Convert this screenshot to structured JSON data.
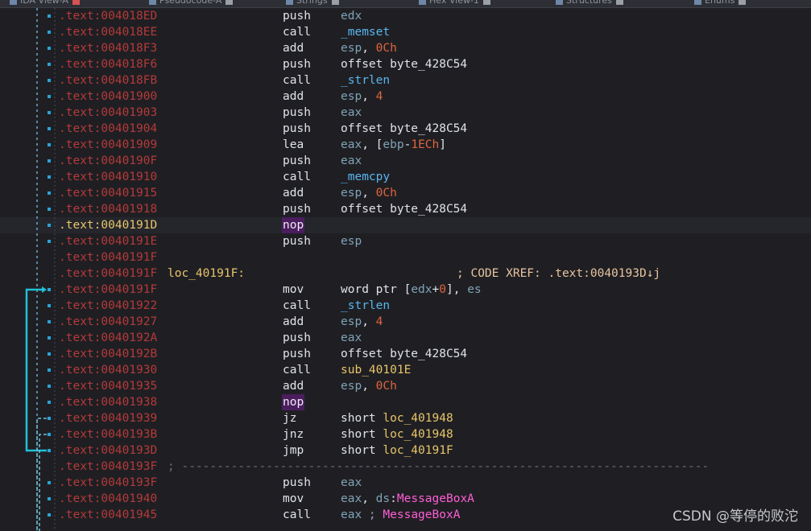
{
  "tabs": [
    {
      "label": "IDA View-A",
      "active": true
    },
    {
      "label": "Pseudocode-A",
      "active": false
    },
    {
      "label": "Strings",
      "active": false
    },
    {
      "label": "Hex View-1",
      "active": false
    },
    {
      "label": "Structures",
      "active": false
    },
    {
      "label": "Enums",
      "active": false
    }
  ],
  "watermark": "CSDN @等停的败沱",
  "colors": {
    "address": "#b33a3a",
    "address_current": "#e8c56a",
    "label": "#e8c56a",
    "register": "#7fa2b6",
    "number": "#e0653e",
    "function": "#59b6ef",
    "import": "#ff5dd6",
    "nop_bg": "#4a1d5d",
    "arrow": "#20c0d8"
  },
  "rows": [
    {
      "addr": ".text:004018ED",
      "mn": "push",
      "ops": [
        {
          "t": "edx",
          "c": "reg"
        }
      ]
    },
    {
      "addr": ".text:004018EE",
      "mn": "call",
      "ops": [
        {
          "t": "_memset",
          "c": "fn"
        }
      ]
    },
    {
      "addr": ".text:004018F3",
      "mn": "add",
      "ops": [
        {
          "t": "esp",
          "c": "reg"
        },
        {
          "t": ", ",
          "c": ""
        },
        {
          "t": "0Ch",
          "c": "num"
        }
      ]
    },
    {
      "addr": ".text:004018F6",
      "mn": "push",
      "ops": [
        {
          "t": "offset byte_428C54",
          "c": ""
        }
      ]
    },
    {
      "addr": ".text:004018FB",
      "mn": "call",
      "ops": [
        {
          "t": "_strlen",
          "c": "fn"
        }
      ]
    },
    {
      "addr": ".text:00401900",
      "mn": "add",
      "ops": [
        {
          "t": "esp",
          "c": "reg"
        },
        {
          "t": ", ",
          "c": ""
        },
        {
          "t": "4",
          "c": "num"
        }
      ]
    },
    {
      "addr": ".text:00401903",
      "mn": "push",
      "ops": [
        {
          "t": "eax",
          "c": "reg"
        }
      ]
    },
    {
      "addr": ".text:00401904",
      "mn": "push",
      "ops": [
        {
          "t": "offset byte_428C54",
          "c": ""
        }
      ]
    },
    {
      "addr": ".text:00401909",
      "mn": "lea",
      "ops": [
        {
          "t": "eax",
          "c": "reg"
        },
        {
          "t": ", [",
          "c": ""
        },
        {
          "t": "ebp",
          "c": "reg"
        },
        {
          "t": "-",
          "c": ""
        },
        {
          "t": "1ECh",
          "c": "num"
        },
        {
          "t": "]",
          "c": ""
        }
      ]
    },
    {
      "addr": ".text:0040190F",
      "mn": "push",
      "ops": [
        {
          "t": "eax",
          "c": "reg"
        }
      ]
    },
    {
      "addr": ".text:00401910",
      "mn": "call",
      "ops": [
        {
          "t": "_memcpy",
          "c": "fn"
        }
      ]
    },
    {
      "addr": ".text:00401915",
      "mn": "add",
      "ops": [
        {
          "t": "esp",
          "c": "reg"
        },
        {
          "t": ", ",
          "c": ""
        },
        {
          "t": "0Ch",
          "c": "num"
        }
      ]
    },
    {
      "addr": ".text:00401918",
      "mn": "push",
      "ops": [
        {
          "t": "offset byte_428C54",
          "c": ""
        }
      ]
    },
    {
      "addr": ".text:0040191D",
      "mn": "nop",
      "ops": [],
      "current": true
    },
    {
      "addr": ".text:0040191E",
      "mn": "push",
      "ops": [
        {
          "t": "esp",
          "c": "reg"
        }
      ]
    },
    {
      "addr": ".text:0040191F",
      "mn": "",
      "ops": []
    },
    {
      "addr": ".text:0040191F",
      "label": "loc_40191F:",
      "xref": "; CODE XREF: .text:0040193D↓j",
      "mn": "",
      "ops": []
    },
    {
      "addr": ".text:0040191F",
      "mn": "mov",
      "ops": [
        {
          "t": "word ptr [",
          "c": ""
        },
        {
          "t": "edx",
          "c": "reg"
        },
        {
          "t": "+",
          "c": ""
        },
        {
          "t": "0",
          "c": "num"
        },
        {
          "t": "], ",
          "c": ""
        },
        {
          "t": "es",
          "c": "reg"
        }
      ]
    },
    {
      "addr": ".text:00401922",
      "mn": "call",
      "ops": [
        {
          "t": "_strlen",
          "c": "fn"
        }
      ]
    },
    {
      "addr": ".text:00401927",
      "mn": "add",
      "ops": [
        {
          "t": "esp",
          "c": "reg"
        },
        {
          "t": ", ",
          "c": ""
        },
        {
          "t": "4",
          "c": "num"
        }
      ]
    },
    {
      "addr": ".text:0040192A",
      "mn": "push",
      "ops": [
        {
          "t": "eax",
          "c": "reg"
        }
      ]
    },
    {
      "addr": ".text:0040192B",
      "mn": "push",
      "ops": [
        {
          "t": "offset byte_428C54",
          "c": ""
        }
      ]
    },
    {
      "addr": ".text:00401930",
      "mn": "call",
      "ops": [
        {
          "t": "sub_40101E",
          "c": "lbl"
        }
      ]
    },
    {
      "addr": ".text:00401935",
      "mn": "add",
      "ops": [
        {
          "t": "esp",
          "c": "reg"
        },
        {
          "t": ", ",
          "c": ""
        },
        {
          "t": "0Ch",
          "c": "num"
        }
      ]
    },
    {
      "addr": ".text:00401938",
      "mn": "nop",
      "ops": []
    },
    {
      "addr": ".text:00401939",
      "mn": "jz",
      "ops": [
        {
          "t": "short ",
          "c": ""
        },
        {
          "t": "loc_401948",
          "c": "lbl"
        }
      ]
    },
    {
      "addr": ".text:0040193B",
      "mn": "jnz",
      "ops": [
        {
          "t": "short ",
          "c": ""
        },
        {
          "t": "loc_401948",
          "c": "lbl"
        }
      ]
    },
    {
      "addr": ".text:0040193D",
      "mn": "jmp",
      "ops": [
        {
          "t": "short ",
          "c": ""
        },
        {
          "t": "loc_40191F",
          "c": "lbl"
        }
      ]
    },
    {
      "addr": ".text:0040193F",
      "sep": "; ---------------------------------------------------------------------------",
      "mn": "",
      "ops": []
    },
    {
      "addr": ".text:0040193F",
      "mn": "push",
      "ops": [
        {
          "t": "eax",
          "c": "reg"
        }
      ]
    },
    {
      "addr": ".text:00401940",
      "mn": "mov",
      "ops": [
        {
          "t": "eax",
          "c": "reg"
        },
        {
          "t": ", ",
          "c": ""
        },
        {
          "t": "ds",
          "c": "reg"
        },
        {
          "t": ":",
          "c": ""
        },
        {
          "t": "MessageBoxA",
          "c": "imp"
        }
      ]
    },
    {
      "addr": ".text:00401945",
      "mn": "call",
      "ops": [
        {
          "t": "eax",
          "c": "reg"
        },
        {
          "t": " ; ",
          "c": "cm"
        },
        {
          "t": "MessageBoxA",
          "c": "imp"
        }
      ]
    }
  ]
}
